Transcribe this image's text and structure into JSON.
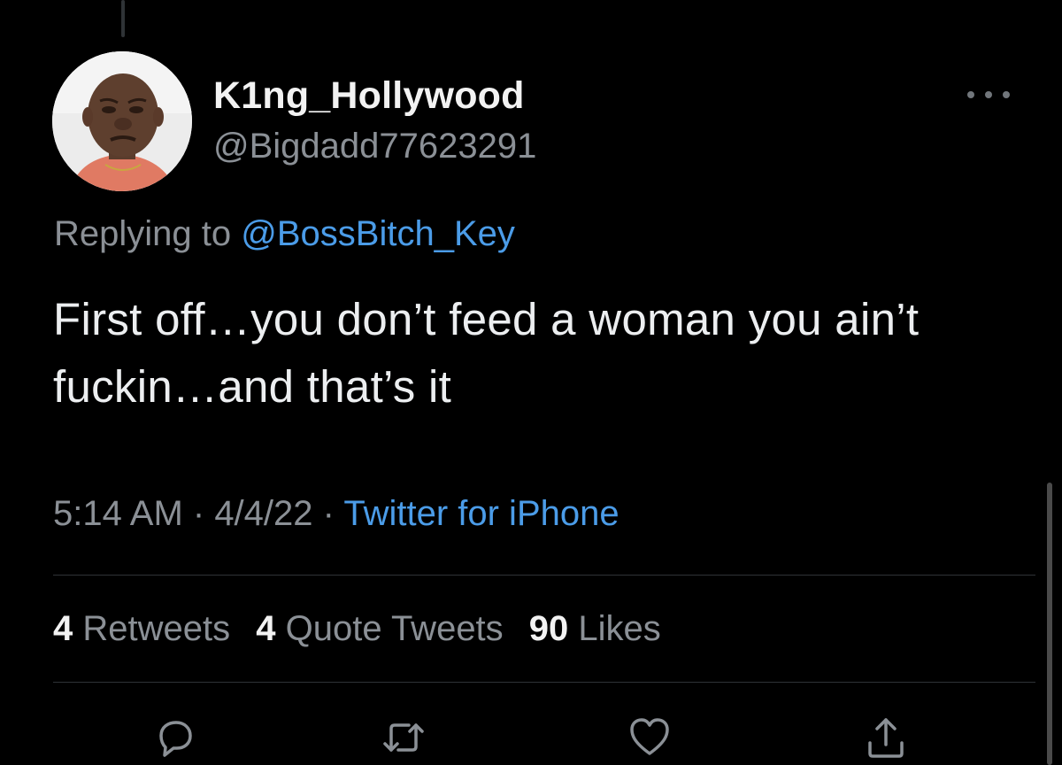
{
  "user": {
    "display_name": "K1ng_Hollywood",
    "handle": "@Bigdadd77623291"
  },
  "reply": {
    "prefix": "Replying to ",
    "mention": "@BossBitch_Key"
  },
  "tweet": {
    "text": "First off…you don’t feed a woman you ain’t fuckin…and that’s it",
    "time": "5:14 AM",
    "date": "4/4/22",
    "separator": " · ",
    "source": "Twitter for iPhone"
  },
  "stats": {
    "retweets_count": "4",
    "retweets_label": " Retweets",
    "quotes_count": "4",
    "quotes_label": " Quote Tweets",
    "likes_count": "90",
    "likes_label": " Likes"
  },
  "icons": {
    "reply": "reply-icon",
    "retweet": "retweet-icon",
    "like": "heart-icon",
    "share": "share-icon",
    "more": "more-icon"
  },
  "colors": {
    "background": "#000000",
    "text": "#e7e9ea",
    "secondary": "#8b9096",
    "link": "#4b9ce8",
    "divider": "#2f3336"
  }
}
